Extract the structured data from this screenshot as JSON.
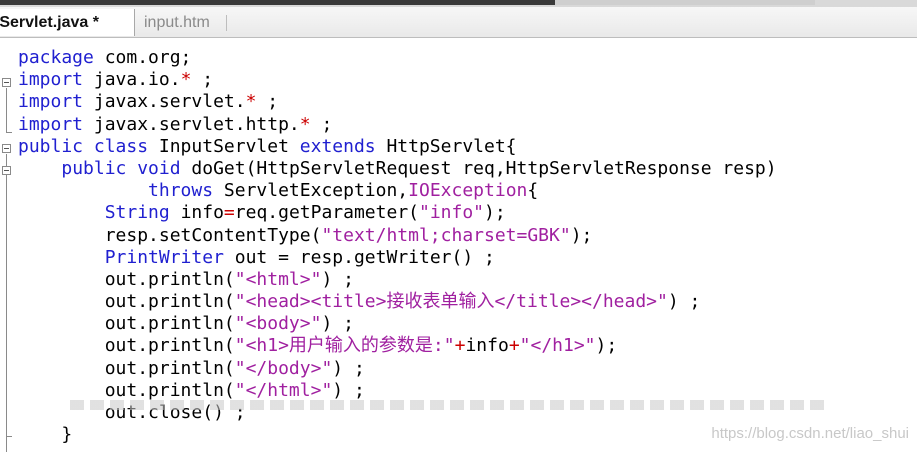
{
  "tabs": [
    {
      "label": "tServlet.java *",
      "active": true
    },
    {
      "label": "input.htm",
      "active": false
    }
  ],
  "code_lines": [
    [
      {
        "t": "package",
        "c": "kw"
      },
      {
        "t": " com.org;",
        "c": ""
      }
    ],
    [
      {
        "t": "import",
        "c": "kw"
      },
      {
        "t": " java.io.",
        "c": ""
      },
      {
        "t": "*",
        "c": "op"
      },
      {
        "t": " ;",
        "c": ""
      }
    ],
    [
      {
        "t": "import",
        "c": "kw"
      },
      {
        "t": " javax.servlet.",
        "c": ""
      },
      {
        "t": "*",
        "c": "op"
      },
      {
        "t": " ;",
        "c": ""
      }
    ],
    [
      {
        "t": "import",
        "c": "kw"
      },
      {
        "t": " javax.servlet.http.",
        "c": ""
      },
      {
        "t": "*",
        "c": "op"
      },
      {
        "t": " ;",
        "c": ""
      }
    ],
    [
      {
        "t": "public class",
        "c": "kw"
      },
      {
        "t": " InputServlet ",
        "c": ""
      },
      {
        "t": "extends",
        "c": "kw"
      },
      {
        "t": " HttpServlet{",
        "c": ""
      }
    ],
    [
      {
        "t": "    ",
        "c": ""
      },
      {
        "t": "public void",
        "c": "kw"
      },
      {
        "t": " doGet(HttpServletRequest req,HttpServletResponse resp)",
        "c": ""
      }
    ],
    [
      {
        "t": "            ",
        "c": ""
      },
      {
        "t": "throws",
        "c": "kw"
      },
      {
        "t": " ServletException,",
        "c": ""
      },
      {
        "t": "IOException",
        "c": "str"
      },
      {
        "t": "{",
        "c": ""
      }
    ],
    [
      {
        "t": "        ",
        "c": ""
      },
      {
        "t": "String",
        "c": "typ"
      },
      {
        "t": " info",
        "c": ""
      },
      {
        "t": "=",
        "c": "op"
      },
      {
        "t": "req.getParameter(",
        "c": ""
      },
      {
        "t": "\"info\"",
        "c": "str"
      },
      {
        "t": ");",
        "c": ""
      }
    ],
    [
      {
        "t": "        resp.setContentType(",
        "c": ""
      },
      {
        "t": "\"text/html;charset=GBK\"",
        "c": "str"
      },
      {
        "t": ");",
        "c": ""
      }
    ],
    [
      {
        "t": "        ",
        "c": ""
      },
      {
        "t": "PrintWriter",
        "c": "typ"
      },
      {
        "t": " out = resp.getWriter() ;",
        "c": ""
      }
    ],
    [
      {
        "t": "        out.println(",
        "c": ""
      },
      {
        "t": "\"<html>\"",
        "c": "str"
      },
      {
        "t": ") ;",
        "c": ""
      }
    ],
    [
      {
        "t": "        out.println(",
        "c": ""
      },
      {
        "t": "\"<head><title>接收表单输入</title></head>\"",
        "c": "str"
      },
      {
        "t": ") ;",
        "c": ""
      }
    ],
    [
      {
        "t": "        out.println(",
        "c": ""
      },
      {
        "t": "\"<body>\"",
        "c": "str"
      },
      {
        "t": ") ;",
        "c": ""
      }
    ],
    [
      {
        "t": "        out.println(",
        "c": ""
      },
      {
        "t": "\"<h1>用户输入的参数是:\"",
        "c": "str"
      },
      {
        "t": "+",
        "c": "op"
      },
      {
        "t": "info",
        "c": ""
      },
      {
        "t": "+",
        "c": "op"
      },
      {
        "t": "\"</h1>\"",
        "c": "str"
      },
      {
        "t": ");",
        "c": ""
      }
    ],
    [
      {
        "t": "        out.println(",
        "c": ""
      },
      {
        "t": "\"</body>\"",
        "c": "str"
      },
      {
        "t": ") ;",
        "c": ""
      }
    ],
    [
      {
        "t": "        out.println(",
        "c": ""
      },
      {
        "t": "\"</html>\"",
        "c": "str"
      },
      {
        "t": ") ;",
        "c": ""
      }
    ],
    [
      {
        "t": "        out.close() ;",
        "c": ""
      }
    ],
    [
      {
        "t": "    }",
        "c": ""
      }
    ]
  ],
  "watermark": "https://blog.csdn.net/liao_shui"
}
